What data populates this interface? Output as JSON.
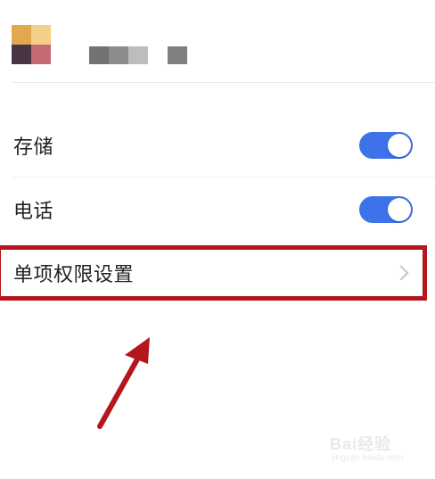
{
  "header": {
    "app_icon_name": "app-icon-pixelated",
    "icon_colors": [
      "#e8a848",
      "#f0c070",
      "#6b4a5a",
      "#c86a78"
    ],
    "name_blur_colors": [
      "#777777",
      "#8a8a8a",
      "#a0a0a0",
      "#b8b8b8",
      "#ffffff",
      "#888888"
    ]
  },
  "permissions": [
    {
      "label": "存储",
      "enabled": true
    },
    {
      "label": "电话",
      "enabled": true
    }
  ],
  "single_permission": {
    "label": "单项权限设置",
    "icon": "chevron-right-icon"
  },
  "annotation": {
    "highlight_color": "#b3171b",
    "arrow_color": "#b3171b"
  },
  "watermark": {
    "text": "Bai经验",
    "sub": "jingyan.baidu.com"
  },
  "colors": {
    "toggle_on": "#3d72e8",
    "text": "#222222"
  }
}
